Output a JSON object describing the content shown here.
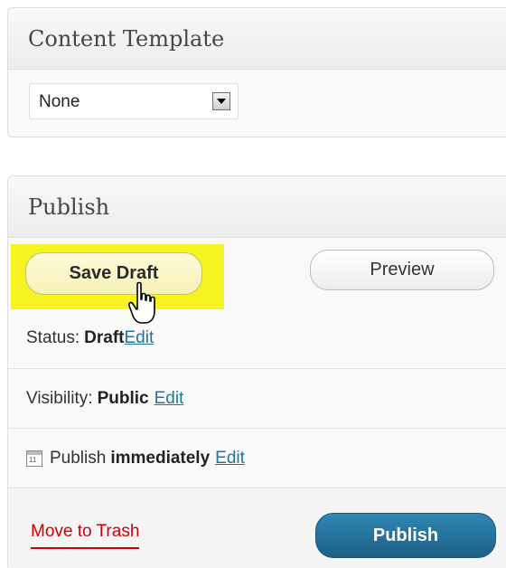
{
  "content_template": {
    "title": "Content Template",
    "select_value": "None"
  },
  "publish": {
    "title": "Publish",
    "save_draft_label": "Save Draft",
    "preview_label": "Preview",
    "status_label": "Status:",
    "status_value": "Draft",
    "status_edit": "Edit",
    "visibility_label": "Visibility:",
    "visibility_value": "Public",
    "visibility_edit": "Edit",
    "schedule_label": "Publish",
    "schedule_value": "immediately",
    "schedule_edit": "Edit",
    "calendar_icon_text": "11",
    "trash_label": "Move to Trash",
    "publish_label": "Publish"
  },
  "colors": {
    "highlight": "#f5f322",
    "link": "#21759b",
    "trash": "#d40000",
    "publish_button": "#21759b"
  },
  "icons": {
    "select_arrow": "chevron-down-icon",
    "calendar": "calendar-icon",
    "cursor": "hand-pointer-cursor-icon"
  }
}
